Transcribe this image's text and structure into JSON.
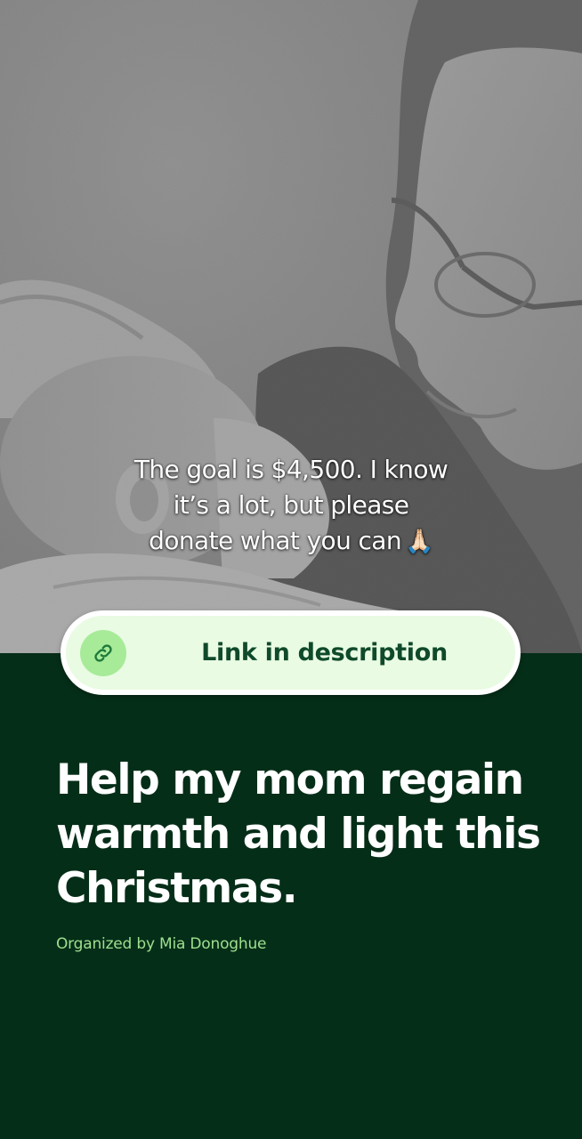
{
  "photo": {
    "description_icon": "black-and-white-photo"
  },
  "caption": {
    "line1": "The goal is $4,500. I know",
    "line2": "it’s a lot, but please",
    "line3": "donate what you can",
    "emoji": "🙏🏻"
  },
  "link": {
    "label": "Link in description",
    "icon": "link-icon"
  },
  "fundraiser": {
    "title": "Help my mom regain warmth and light this Christmas.",
    "organizer": "Organized by Mia Donoghue"
  },
  "colors": {
    "background": "#052e18",
    "pill": "#e9fbe3",
    "icon_circle": "#a7eb99",
    "link_text": "#0f4a2a",
    "organizer_text": "#9ee08e"
  }
}
